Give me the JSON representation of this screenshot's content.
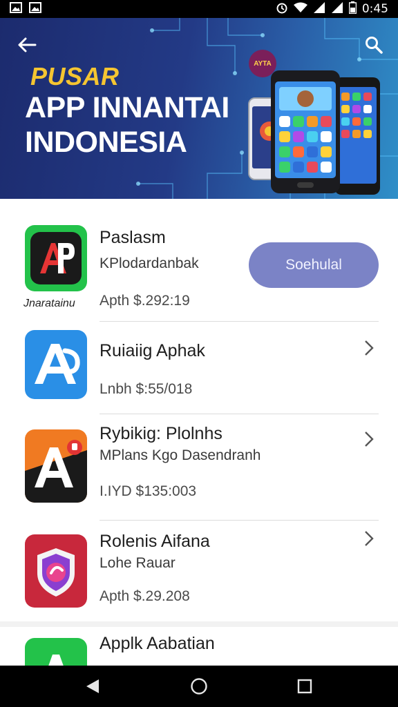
{
  "status_bar": {
    "time": "0:45",
    "left_icons": [
      "image-icon",
      "image-icon"
    ],
    "right_icons": [
      "alarm-icon",
      "wifi-icon",
      "signal-icon",
      "signal-icon",
      "battery-icon"
    ]
  },
  "banner": {
    "pretitle": "PUSAR",
    "title_line1": "APP INNANTAI",
    "title_line2": "INDONESIA",
    "badge_text": "AYTA",
    "colors": {
      "pretitle": "#f5c531",
      "bg_start": "#1c2b6e",
      "bg_end": "#2f8fc8"
    }
  },
  "apps": [
    {
      "name": "Paslasm",
      "subtitle": "KPlodardanbak",
      "price": "Apth $.292:19",
      "icon": "ap-logo-icon",
      "icon_caption": "Jnaratainu",
      "action_label": "Soehulal",
      "icon_color": "#23c24a"
    },
    {
      "name": "Ruiaiig Aphak",
      "subtitle": "",
      "price": "Lnbh $:55/018",
      "icon": "letter-a-icon",
      "icon_color": "#2a8fe6"
    },
    {
      "name": "Rybikig: Plolnhs",
      "subtitle": "MPlans Kgo Dasendranh",
      "price": "I.IYD $135:003",
      "icon": "a-lock-icon",
      "icon_color": "#f07a22"
    },
    {
      "name": "Rolenis Aifana",
      "subtitle": "Lohe Rauar",
      "price": "Apth $.29.208",
      "icon": "shield-icon",
      "icon_color": "#c8283c"
    },
    {
      "name": "Applk Aabatian",
      "subtitle": "",
      "price": "",
      "icon": "letter-a-icon",
      "icon_color": "#23c24a"
    }
  ],
  "accent": "#7b83c6"
}
